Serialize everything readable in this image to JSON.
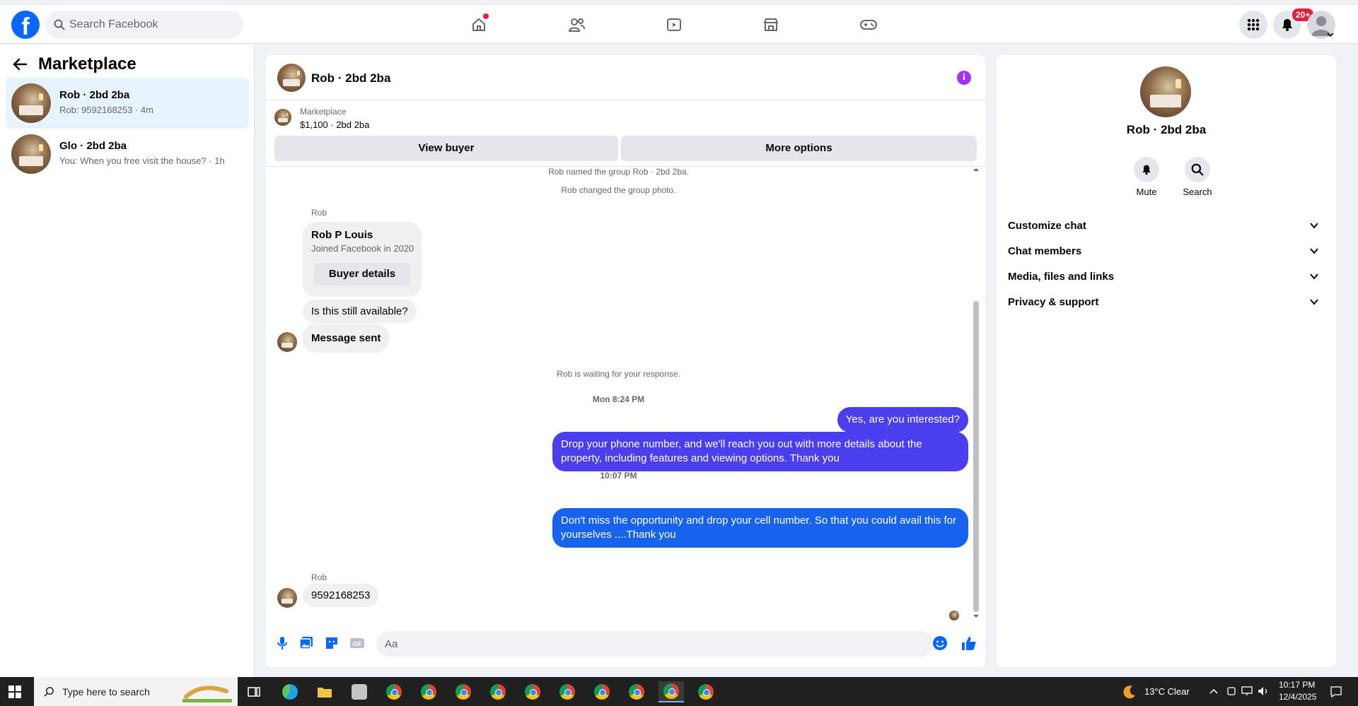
{
  "topbar": {
    "logo": "f",
    "search_placeholder": "Search Facebook",
    "notifications_badge": "20+"
  },
  "left": {
    "title": "Marketplace",
    "conversations": [
      {
        "title": "Rob · 2bd 2ba",
        "subtitle": "Rob: 9592168253 · 4m",
        "active": true
      },
      {
        "title": "Glo · 2bd 2ba",
        "subtitle": "You: When you free visit the house? · 1h",
        "active": false
      }
    ]
  },
  "chat": {
    "title": "Rob · 2bd 2ba",
    "listing": {
      "label": "Marketplace",
      "price": "$1,100 · 2bd 2ba"
    },
    "buttons": {
      "view_buyer": "View buyer",
      "more_options": "More options"
    },
    "system": {
      "named": "Rob named the group Rob · 2bd 2ba.",
      "photo": "Rob changed the group photo.",
      "waiting": "Rob is waiting for your response."
    },
    "card": {
      "sender": "Rob",
      "name": "Rob P Louis",
      "joined": "Joined Facebook in 2020",
      "button": "Buyer details"
    },
    "incoming_1": "Is this still available?",
    "incoming_2": "Message sent",
    "time_1": "Mon 8:24 PM",
    "outgoing_1": "Yes, are you interested?",
    "outgoing_2": "Drop your phone number, and we'll reach you out with more details about the property, including features and viewing options.  Thank you",
    "time_2": "10:07 PM",
    "outgoing_3": "Don't miss the opportunity and drop your cell number. So that you could  avail this for yourselves ....Thank you",
    "sender_2": "Rob",
    "incoming_3": "9592168253",
    "composer_placeholder": "Aa"
  },
  "right": {
    "title": "Rob · 2bd 2ba",
    "actions": {
      "mute": "Mute",
      "search": "Search"
    },
    "sections": [
      "Customize chat",
      "Chat members",
      "Media, files and links",
      "Privacy & support"
    ]
  },
  "taskbar": {
    "search_placeholder": "Type here to search",
    "weather": "13°C  Clear",
    "time": "10:17 PM",
    "date": "12/4/2025"
  },
  "colors": {
    "brand": "#0866ff",
    "outgoing": "#4a3eef",
    "outgoing_alt": "#1862f0",
    "info": "#a033ff"
  }
}
